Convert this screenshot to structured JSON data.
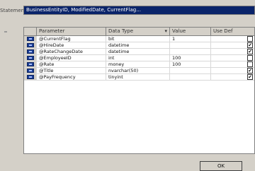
{
  "window": {
    "name_label": "Statement",
    "name_value": "BusinessEntityID, ModifiedDate, CurrentFlag..."
  },
  "grid": {
    "columns": [
      "Parameter",
      "Data Type",
      "Value",
      "Use Def"
    ],
    "rows": [
      {
        "parameter": "@CurrentFlag",
        "data_type": "bit",
        "value": "1",
        "use_default": false
      },
      {
        "parameter": "@HireDate",
        "data_type": "datetime",
        "value": "",
        "use_default": true
      },
      {
        "parameter": "@RateChangeDate",
        "data_type": "datetime",
        "value": "",
        "use_default": true
      },
      {
        "parameter": "@EmployeeID",
        "data_type": "int",
        "value": "100",
        "use_default": false
      },
      {
        "parameter": "@Rate",
        "data_type": "money",
        "value": "100",
        "use_default": false
      },
      {
        "parameter": "@Title",
        "data_type": "nvarchar(50)",
        "value": "",
        "use_default": true
      },
      {
        "parameter": "@PayFrequency",
        "data_type": "tinyint",
        "value": "",
        "use_default": true
      }
    ]
  },
  "footer": {
    "ok_label": "OK"
  }
}
